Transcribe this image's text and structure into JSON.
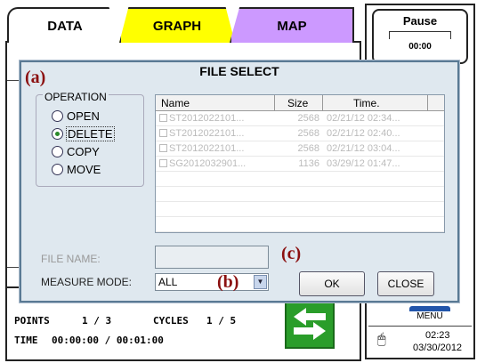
{
  "tabs": [
    {
      "label": "DATA"
    },
    {
      "label": "GRAPH"
    },
    {
      "label": "MAP"
    }
  ],
  "side": {
    "pause_label": "Pause",
    "timer": "00:00",
    "menu_label": "MENU",
    "clock_time": "02:23",
    "clock_date": "03/30/2012"
  },
  "status": {
    "points_label": "POINTS",
    "points_value": "1 / 3",
    "cycles_label": "CYCLES",
    "cycles_value": "1 / 5",
    "time_label": "TIME",
    "time_value": "00:00:00 / 00:01:00"
  },
  "dialog": {
    "title": "FILE SELECT",
    "annot_a": "(a)",
    "annot_b": "(b)",
    "annot_c": "(c)",
    "operation_legend": "OPERATION",
    "operations": [
      {
        "label": "OPEN",
        "selected": false
      },
      {
        "label": "DELETE",
        "selected": true
      },
      {
        "label": "COPY",
        "selected": false
      },
      {
        "label": "MOVE",
        "selected": false
      }
    ],
    "columns": [
      "Name",
      "Size",
      "Time."
    ],
    "files": [
      {
        "name": "ST2012022101...",
        "size": "2568",
        "time": "02/21/12 02:34..."
      },
      {
        "name": "ST2012022101...",
        "size": "2568",
        "time": "02/21/12 02:40..."
      },
      {
        "name": "ST2012022101...",
        "size": "2568",
        "time": "02/21/12 03:04..."
      },
      {
        "name": "SG2012032901...",
        "size": "1136",
        "time": "03/29/12 01:47..."
      }
    ],
    "file_name_label": "FILE NAME:",
    "file_name_value": "",
    "measure_mode_label": "MEASURE MODE:",
    "measure_mode_value": "ALL",
    "ok_label": "OK",
    "close_label": "CLOSE"
  }
}
